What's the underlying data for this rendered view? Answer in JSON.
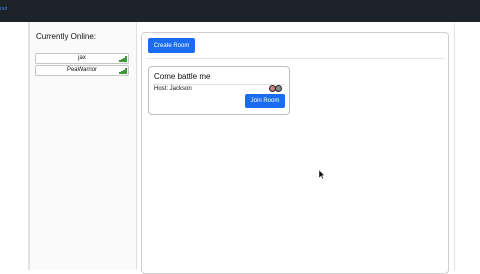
{
  "header": {
    "brand": "ord"
  },
  "sidebar": {
    "title": "Currently Online:",
    "users": [
      {
        "name": "jax",
        "signal_icon": "signal-bars-icon"
      },
      {
        "name": "PeaWarrior",
        "signal_icon": "signal-bars-icon"
      }
    ]
  },
  "main": {
    "create_room_label": "Create Room",
    "rooms": [
      {
        "title": "Come battle me",
        "host_label": "Host: Jackson",
        "join_label": "Join Room"
      }
    ]
  },
  "colors": {
    "topbar": "#1d2429",
    "primary_button": "#1a6cf0",
    "signal_green": "#3a9a3a"
  }
}
